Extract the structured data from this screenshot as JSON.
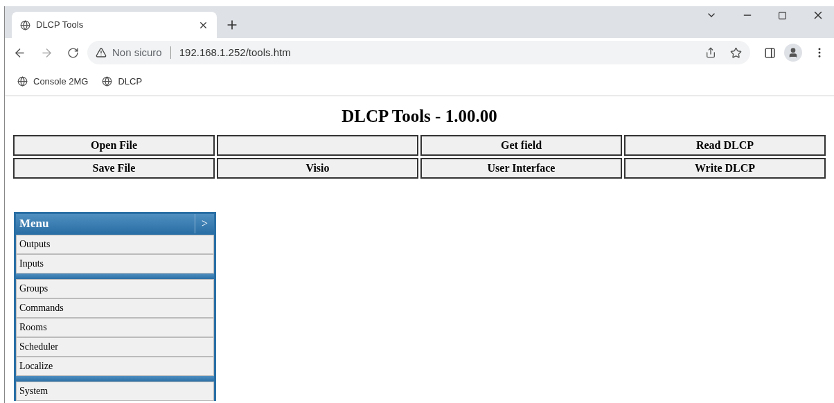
{
  "tab": {
    "title": "DLCP Tools",
    "selected": true
  },
  "address": {
    "security": "Non sicuro",
    "url": "192.168.1.252/tools.htm"
  },
  "bookmarks": [
    "Console 2MG",
    "DLCP"
  ],
  "page": {
    "title": "DLCP Tools - 1.00.00",
    "button_rows": [
      [
        {
          "kind": "button",
          "label": "Open File"
        },
        {
          "kind": "blank"
        },
        {
          "kind": "button",
          "label": "Get field"
        },
        {
          "kind": "button",
          "label": "Read DLCP"
        }
      ],
      [
        {
          "kind": "button",
          "label": "Save File"
        },
        {
          "kind": "button",
          "label": "Visio"
        },
        {
          "kind": "button",
          "label": "User Interface"
        },
        {
          "kind": "button",
          "label": "Write DLCP"
        }
      ]
    ],
    "menu": {
      "title": "Menu",
      "toggle": ">",
      "items": [
        {
          "kind": "item",
          "label": "Outputs"
        },
        {
          "kind": "item",
          "label": "Inputs"
        },
        {
          "kind": "separator"
        },
        {
          "kind": "item",
          "label": "Groups"
        },
        {
          "kind": "item",
          "label": "Commands"
        },
        {
          "kind": "item",
          "label": "Rooms"
        },
        {
          "kind": "item",
          "label": "Scheduler"
        },
        {
          "kind": "item",
          "label": "Localize"
        },
        {
          "kind": "separator"
        },
        {
          "kind": "item",
          "label": "System"
        }
      ]
    }
  }
}
